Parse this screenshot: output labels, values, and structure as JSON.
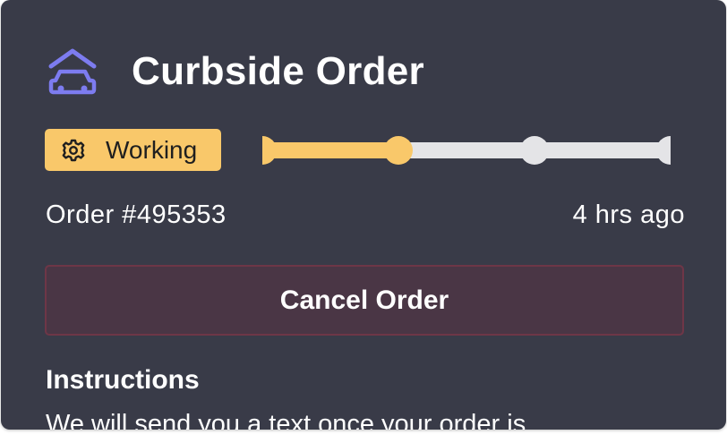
{
  "header": {
    "title": "Curbside Order",
    "icon": "curbside-car-icon",
    "icon_color": "#7d7cf0"
  },
  "status": {
    "label": "Working",
    "icon": "gear-icon",
    "color": "#f9c86a",
    "steps_total": 4,
    "steps_complete": 2
  },
  "order": {
    "number": "Order #495353",
    "time_ago": "4 hrs ago"
  },
  "actions": {
    "cancel_label": "Cancel Order"
  },
  "instructions": {
    "heading": "Instructions",
    "text": "We will send you a text once your order is"
  },
  "colors": {
    "card_bg": "#393b48",
    "progress_active": "#f9c86a",
    "progress_inactive": "#e4e4e7",
    "cancel_bg": "#4a3645",
    "cancel_border": "#6e3647"
  }
}
